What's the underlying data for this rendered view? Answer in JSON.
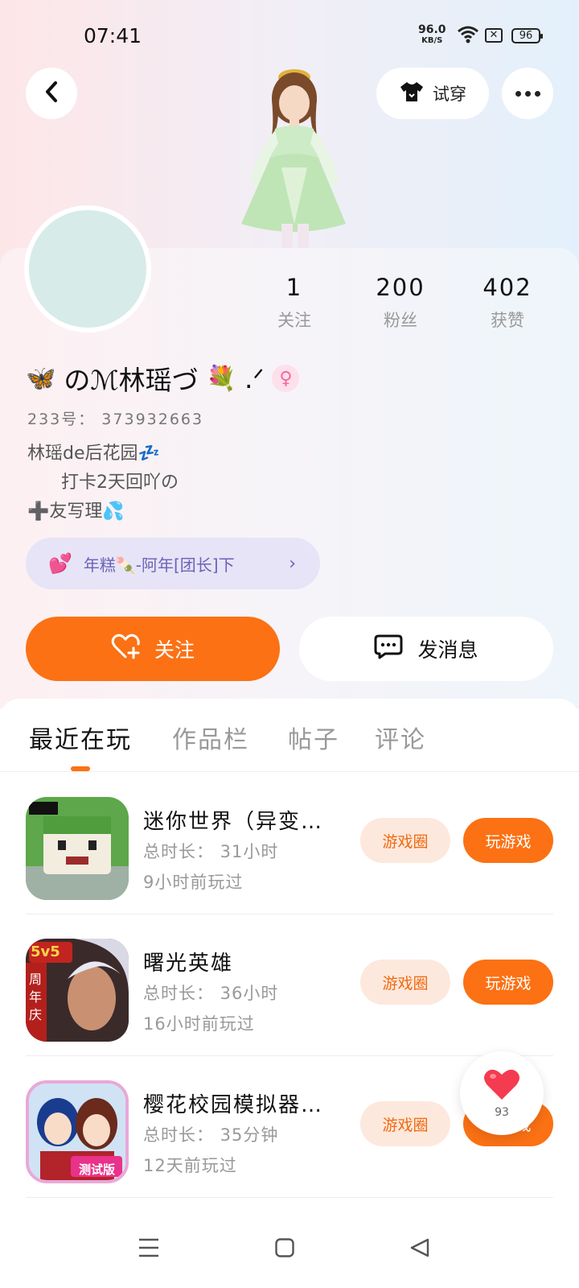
{
  "status_bar": {
    "time": "07:41",
    "net_speed": "96.0",
    "net_unit": "KB/S",
    "battery": "96"
  },
  "header": {
    "try_on_label": "试穿"
  },
  "profile": {
    "stats": [
      {
        "value": "1",
        "label": "关注"
      },
      {
        "value": "200",
        "label": "粉丝"
      },
      {
        "value": "402",
        "label": "获赞"
      }
    ],
    "name_prefix_emoji": "🦋",
    "name": "のℳ林瑶づ",
    "name_suffix_emoji": "💐",
    "name_tail": ".ᐟ",
    "gender_symbol": "♀",
    "uid": "233号： 373932663",
    "bio": "林瑶de后花园💤\n      打卡2天回吖の\n➕友写理💦",
    "guild_label": "年糕🍡-阿年[团长]下",
    "follow_label": "关注",
    "message_label": "发消息"
  },
  "tabs": [
    {
      "label": "最近在玩",
      "active": true
    },
    {
      "label": "作品栏",
      "active": false
    },
    {
      "label": "帖子",
      "active": false
    },
    {
      "label": "评论",
      "active": false
    }
  ],
  "games": [
    {
      "name": "迷你世界（异变…",
      "total": "总时长： 31小时",
      "last": "9小时前玩过",
      "circle_label": "游戏圈",
      "play_label": "玩游戏"
    },
    {
      "name": "曙光英雄",
      "total": "总时长： 36小时",
      "last": "16小时前玩过",
      "circle_label": "游戏圈",
      "play_label": "玩游戏"
    },
    {
      "name": "樱花校园模拟器…",
      "total": "总时长： 35分钟",
      "last": "12天前玩过",
      "circle_label": "游戏圈",
      "play_label": "玩游戏"
    }
  ],
  "game_icon_text": {
    "icon2_badge": "5v5",
    "icon2_side": "周年庆",
    "icon3_badge": "测试版"
  },
  "like_count": "93",
  "colors": {
    "accent": "#fb7114",
    "accent_soft": "#fde8dd",
    "guild_bg": "#e6e4f6"
  }
}
